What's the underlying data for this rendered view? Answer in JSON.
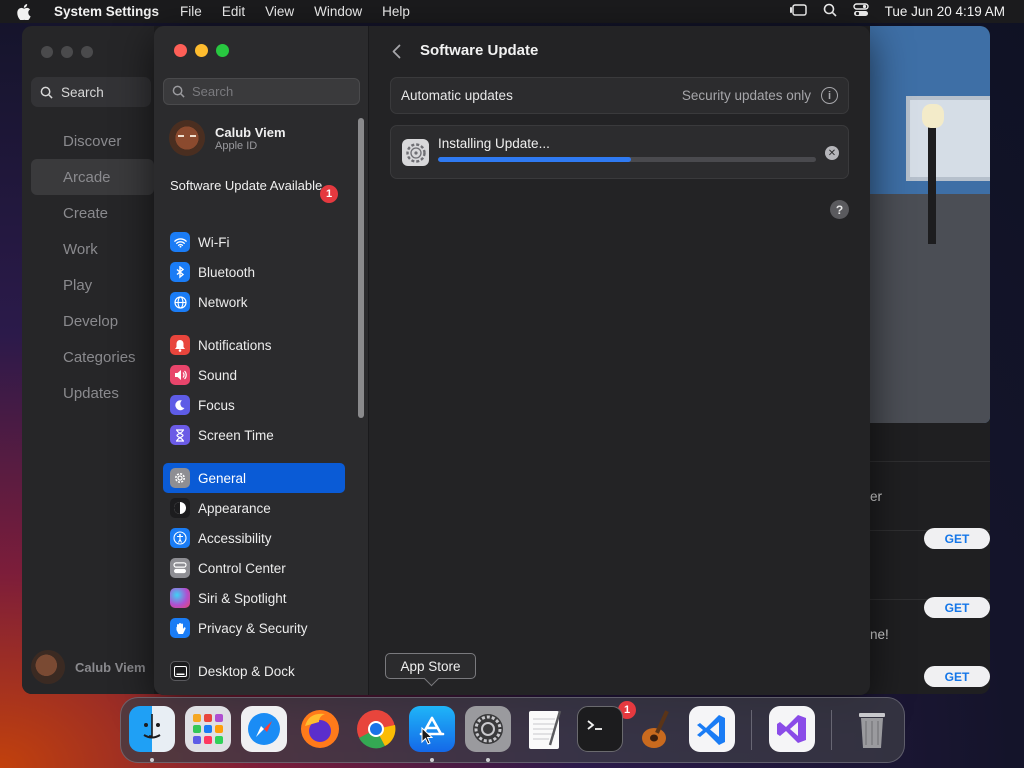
{
  "menubar": {
    "app_name": "System Settings",
    "items": [
      "File",
      "Edit",
      "View",
      "Window",
      "Help"
    ],
    "datetime": "Tue Jun 20  4:19 AM"
  },
  "appstore": {
    "search_placeholder": "Search",
    "nav": [
      "Discover",
      "Arcade",
      "Create",
      "Work",
      "Play",
      "Develop",
      "Categories",
      "Updates"
    ],
    "active_nav": "Arcade",
    "user_name": "Calub Viem",
    "rows": [
      {
        "text": "er",
        "button": "GET"
      },
      {
        "text": "",
        "button": "GET"
      },
      {
        "text": "ne!",
        "button": "GET"
      }
    ]
  },
  "settings": {
    "search_placeholder": "Search",
    "profile": {
      "name": "Calub Viem",
      "sub": "Apple ID"
    },
    "update_available": {
      "label": "Software Update Available",
      "badge": "1"
    },
    "nav_groups": [
      [
        {
          "label": "Wi-Fi",
          "icon": "wifi-icon",
          "color": "#1a7cf5"
        },
        {
          "label": "Bluetooth",
          "icon": "bluetooth-icon",
          "color": "#1a7cf5"
        },
        {
          "label": "Network",
          "icon": "globe-icon",
          "color": "#1a7cf5"
        }
      ],
      [
        {
          "label": "Notifications",
          "icon": "bell-icon",
          "color": "#e8453c"
        },
        {
          "label": "Sound",
          "icon": "speaker-icon",
          "color": "#e8456b"
        },
        {
          "label": "Focus",
          "icon": "moon-icon",
          "color": "#5e5ce6"
        },
        {
          "label": "Screen Time",
          "icon": "hourglass-icon",
          "color": "#6b5be6"
        }
      ],
      [
        {
          "label": "General",
          "icon": "gear-icon",
          "color": "#8e8e93",
          "active": true
        },
        {
          "label": "Appearance",
          "icon": "appearance-icon",
          "color": "#1c1c1e"
        },
        {
          "label": "Accessibility",
          "icon": "accessibility-icon",
          "color": "#1a7cf5"
        },
        {
          "label": "Control Center",
          "icon": "control-center-icon",
          "color": "#8e8e93"
        },
        {
          "label": "Siri & Spotlight",
          "icon": "siri-icon",
          "color": "#b04fd0"
        },
        {
          "label": "Privacy & Security",
          "icon": "hand-icon",
          "color": "#1a7cf5"
        }
      ],
      [
        {
          "label": "Desktop & Dock",
          "icon": "dock-icon",
          "color": "#1c1c1e"
        }
      ]
    ],
    "main": {
      "title": "Software Update",
      "auto_label": "Automatic updates",
      "auto_value": "Security updates only",
      "install_label": "Installing Update...",
      "progress": 0.51
    }
  },
  "tooltip": "App Store",
  "dock": {
    "apps": [
      "Finder",
      "Launchpad",
      "Safari",
      "Firefox",
      "Chrome",
      "App Store",
      "System Settings",
      "TextEdit",
      "Terminal",
      "GarageBand",
      "VS Code",
      "Visual Studio",
      "Trash"
    ],
    "settings_badge": "1"
  },
  "colors": {
    "accent": "#0a5bd6",
    "progress": "#2f7af2",
    "badge": "#e5393f"
  }
}
